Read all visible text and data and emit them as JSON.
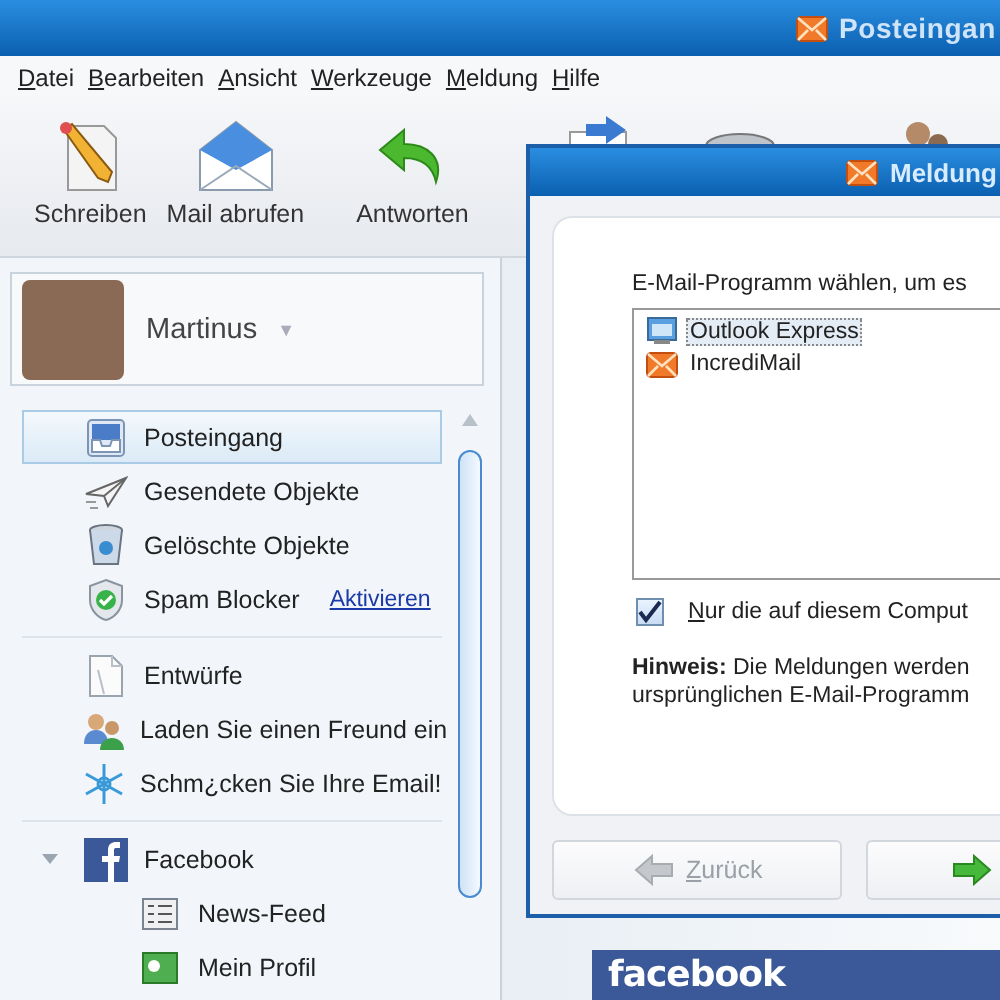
{
  "window": {
    "title": "Posteingan"
  },
  "menu": [
    "Datei",
    "Bearbeiten",
    "Ansicht",
    "Werkzeuge",
    "Meldung",
    "Hilfe"
  ],
  "toolbar": [
    {
      "label": "Schreiben"
    },
    {
      "label": "Mail abrufen"
    },
    {
      "label": "Antworten"
    }
  ],
  "profile": {
    "name": "Martinus",
    "caret": "▼"
  },
  "folder_groups": [
    [
      {
        "label": "Posteingang",
        "selected": true
      },
      {
        "label": "Gesendete Objekte",
        "selected": false
      },
      {
        "label": "Gelöschte Objekte",
        "selected": false
      },
      {
        "label": "Spam Blocker",
        "selected": false,
        "link": "Aktivieren"
      }
    ],
    [
      {
        "label": "Entwürfe",
        "selected": false
      },
      {
        "label": "Laden Sie einen Freund ein",
        "selected": false
      },
      {
        "label": "Schm¿cken Sie Ihre Email!",
        "selected": false
      }
    ],
    [
      {
        "label": "Facebook",
        "selected": false,
        "expanded": true,
        "children": [
          {
            "label": "News-Feed",
            "selected": false
          },
          {
            "label": "Mein Profil",
            "selected": false
          }
        ]
      }
    ]
  ],
  "dialog": {
    "title": "Meldung",
    "prompt": "E-Mail-Programm wählen, um es",
    "programs": [
      {
        "name": "Outlook Express",
        "selected": true
      },
      {
        "name": "IncrediMail",
        "selected": false
      }
    ],
    "only_local": {
      "label": "Nur die auf diesem Comput",
      "checked": true
    },
    "note": [
      "**Hinweis:** Die Meldungen werden",
      "ursprünglichen E-Mail-Programm"
    ],
    "back_button": {
      "label": "Zurück",
      "disabled": true
    },
    "next_button": {
      "disabled": false
    }
  },
  "facebook_banner": {
    "text": "facebook"
  }
}
